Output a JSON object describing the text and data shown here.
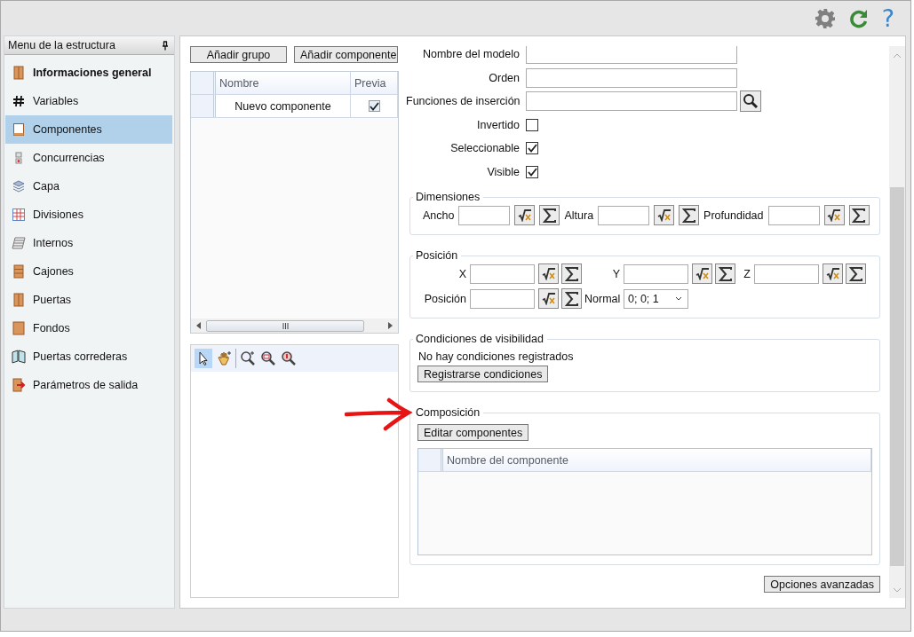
{
  "toolbar": {
    "help_label": "?"
  },
  "sidebar": {
    "title": "Menu de la estructura",
    "items": [
      {
        "label": "Informaciones general",
        "bold": true,
        "selected": false
      },
      {
        "label": "Variables",
        "bold": false,
        "selected": false
      },
      {
        "label": "Componentes",
        "bold": false,
        "selected": true
      },
      {
        "label": "Concurrencias",
        "bold": false,
        "selected": false
      },
      {
        "label": "Capa",
        "bold": false,
        "selected": false
      },
      {
        "label": "Divisiones",
        "bold": false,
        "selected": false
      },
      {
        "label": "Internos",
        "bold": false,
        "selected": false
      },
      {
        "label": "Cajones",
        "bold": false,
        "selected": false
      },
      {
        "label": "Puertas",
        "bold": false,
        "selected": false
      },
      {
        "label": "Fondos",
        "bold": false,
        "selected": false
      },
      {
        "label": "Puertas correderas",
        "bold": false,
        "selected": false
      },
      {
        "label": "Parámetros de salida",
        "bold": false,
        "selected": false
      }
    ]
  },
  "components": {
    "buttons": [
      "Añadir grupo",
      "Añadir componente"
    ],
    "columns": [
      "Nombre",
      "Previa"
    ],
    "rows": [
      {
        "name": "Nuevo componente",
        "preview": true
      }
    ],
    "viewer_tools": [
      {
        "selected": true
      },
      {
        "selected": false
      },
      {
        "selected": false
      },
      {
        "selected": false
      },
      {
        "selected": false
      }
    ]
  },
  "form": {
    "fields": [
      {
        "label": "Nombre del modelo",
        "kind": "text"
      },
      {
        "label": "Orden",
        "kind": "text"
      },
      {
        "label": "Funciones de inserción",
        "kind": "search"
      },
      {
        "label": "Invertido",
        "kind": "checkbox",
        "checked": false
      },
      {
        "label": "Seleccionable",
        "kind": "checkbox",
        "checked": true
      },
      {
        "label": "Visible",
        "kind": "checkbox",
        "checked": true
      }
    ],
    "dimensions": {
      "title": "Dimensiones",
      "fields": [
        "Ancho",
        "Altura",
        "Profundidad"
      ]
    },
    "position": {
      "title": "Posición",
      "fields": [
        "X",
        "Y",
        "Z",
        "Posición"
      ],
      "normal_label": "Normal",
      "normal_value": "0; 0; 1"
    },
    "visibility": {
      "title": "Condiciones de visibilidad",
      "message": "No hay condiciones registrados",
      "button": "Registrarse condiciones"
    },
    "composition": {
      "title": "Composición",
      "button": "Editar componentes",
      "columns": [
        "Nombre del componente"
      ]
    },
    "advanced_button": "Opciones avanzadas"
  }
}
